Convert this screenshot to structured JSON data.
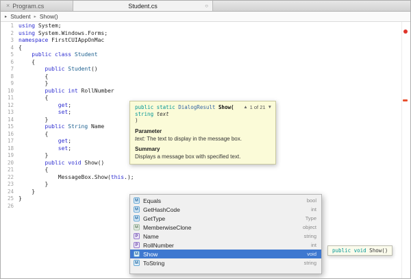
{
  "tabs": {
    "program": {
      "label": "Program.cs",
      "close_icon": "×"
    },
    "student": {
      "label": "Student.cs",
      "modified_icon": "○"
    }
  },
  "breadcrumb": {
    "expander_icon": "▸",
    "scope": "Student",
    "separator": "▸",
    "member": "Show()"
  },
  "editor": {
    "lines": [
      {
        "num": "1",
        "segs": [
          [
            "kw",
            "using"
          ],
          [
            "pl",
            " System;"
          ]
        ]
      },
      {
        "num": "2",
        "segs": [
          [
            "kw",
            "using"
          ],
          [
            "pl",
            " System.Windows.Forms;"
          ]
        ]
      },
      {
        "num": "3",
        "segs": [
          [
            "kw",
            "namespace"
          ],
          [
            "pl",
            " FirstCUIAppOnMac"
          ]
        ]
      },
      {
        "num": "4",
        "segs": [
          [
            "pl",
            "{"
          ]
        ]
      },
      {
        "num": "5",
        "segs": [
          [
            "pl",
            "    "
          ],
          [
            "kw",
            "public"
          ],
          [
            "pl",
            " "
          ],
          [
            "kw",
            "class"
          ],
          [
            "ty",
            " Student"
          ]
        ]
      },
      {
        "num": "6",
        "segs": [
          [
            "pl",
            "    {"
          ]
        ]
      },
      {
        "num": "7",
        "segs": [
          [
            "pl",
            "        "
          ],
          [
            "kw",
            "public"
          ],
          [
            "ty",
            " Student"
          ],
          [
            "pl",
            "()"
          ]
        ]
      },
      {
        "num": "8",
        "segs": [
          [
            "pl",
            "        {"
          ]
        ]
      },
      {
        "num": "9",
        "segs": [
          [
            "pl",
            "        }"
          ]
        ]
      },
      {
        "num": "10",
        "segs": [
          [
            "pl",
            "        "
          ],
          [
            "kw",
            "public"
          ],
          [
            "pl",
            " "
          ],
          [
            "kw",
            "int"
          ],
          [
            "pl",
            " RollNumber"
          ]
        ]
      },
      {
        "num": "11",
        "segs": [
          [
            "pl",
            "        {"
          ]
        ]
      },
      {
        "num": "12",
        "segs": [
          [
            "pl",
            "            "
          ],
          [
            "kw",
            "get"
          ],
          [
            "pl",
            ";"
          ]
        ]
      },
      {
        "num": "13",
        "segs": [
          [
            "pl",
            "            "
          ],
          [
            "kw",
            "set"
          ],
          [
            "pl",
            ";"
          ]
        ]
      },
      {
        "num": "14",
        "segs": [
          [
            "pl",
            "        }"
          ]
        ]
      },
      {
        "num": "15",
        "segs": [
          [
            "pl",
            "        "
          ],
          [
            "kw",
            "public"
          ],
          [
            "ty",
            " String"
          ],
          [
            "pl",
            " Name"
          ]
        ]
      },
      {
        "num": "16",
        "segs": [
          [
            "pl",
            "        {"
          ]
        ]
      },
      {
        "num": "17",
        "segs": [
          [
            "pl",
            "            "
          ],
          [
            "kw",
            "get"
          ],
          [
            "pl",
            ";"
          ]
        ]
      },
      {
        "num": "18",
        "segs": [
          [
            "pl",
            "            "
          ],
          [
            "kw",
            "set"
          ],
          [
            "pl",
            ";"
          ]
        ]
      },
      {
        "num": "19",
        "segs": [
          [
            "pl",
            "        }"
          ]
        ]
      },
      {
        "num": "20",
        "segs": [
          [
            "pl",
            "        "
          ],
          [
            "kw",
            "public"
          ],
          [
            "pl",
            " "
          ],
          [
            "kw",
            "void"
          ],
          [
            "pl",
            " Show()"
          ]
        ]
      },
      {
        "num": "21",
        "segs": [
          [
            "pl",
            "        {"
          ]
        ]
      },
      {
        "num": "22",
        "segs": [
          [
            "pl",
            "            MessageBox.Show("
          ],
          [
            "kw",
            "this"
          ],
          [
            "pl",
            ".);"
          ]
        ]
      },
      {
        "num": "23",
        "segs": [
          [
            "pl",
            "        }"
          ]
        ]
      },
      {
        "num": "24",
        "segs": [
          [
            "pl",
            "    }"
          ]
        ]
      },
      {
        "num": "25",
        "segs": [
          [
            "pl",
            "}"
          ]
        ]
      },
      {
        "num": "26",
        "segs": []
      }
    ]
  },
  "signature_help": {
    "pager": {
      "up_icon": "▲",
      "label": "1 of 21",
      "down_icon": "▼"
    },
    "signature_lines": [
      [
        [
          "tkw",
          "public static"
        ],
        [
          "tty",
          " DialogResult"
        ],
        [
          "tsig",
          " Show("
        ]
      ],
      [
        [
          "tpl",
          "  "
        ],
        [
          "tkw",
          "string"
        ],
        [
          "targ",
          " text"
        ]
      ],
      [
        [
          "tpl",
          ")"
        ]
      ]
    ],
    "sections": {
      "parameter_heading": "Parameter",
      "parameter_term": "text:",
      "parameter_description": "The text to display in the message box.",
      "summary_heading": "Summary",
      "summary_description": "Displays a message box with specified text."
    }
  },
  "completion": {
    "selected_bg": "#3e78d0",
    "items": [
      {
        "label": "Equals",
        "type": "bool",
        "kind": "method",
        "selected": false
      },
      {
        "label": "GetHashCode",
        "type": "int",
        "kind": "method",
        "selected": false
      },
      {
        "label": "GetType",
        "type": "Type",
        "kind": "method",
        "selected": false
      },
      {
        "label": "MemberwiseClone",
        "type": "object",
        "kind": "method_protected",
        "selected": false
      },
      {
        "label": "Name",
        "type": "string",
        "kind": "property",
        "selected": false
      },
      {
        "label": "RollNumber",
        "type": "int",
        "kind": "property",
        "selected": false
      },
      {
        "label": "Show",
        "type": "void",
        "kind": "method",
        "selected": true
      },
      {
        "label": "ToString",
        "type": "string",
        "kind": "method",
        "selected": false
      }
    ],
    "kinds": {
      "method": {
        "glyph": "M",
        "bg": "#e3f1fa",
        "border": "#64a6d4",
        "fg": "#2b6ea6"
      },
      "method_protected": {
        "glyph": "M",
        "bg": "#edf2ed",
        "border": "#a3bba3",
        "fg": "#6b876b"
      },
      "property": {
        "glyph": "P",
        "bg": "#ece5f7",
        "border": "#9678cd",
        "fg": "#6547a5"
      }
    },
    "side_tooltip_segments": [
      [
        "tkw",
        "public void"
      ],
      [
        "tpl",
        " Show()"
      ]
    ]
  },
  "scrollbar": {
    "error_dot_color": "#e0352b",
    "error_marker_color": "#e8502e"
  }
}
